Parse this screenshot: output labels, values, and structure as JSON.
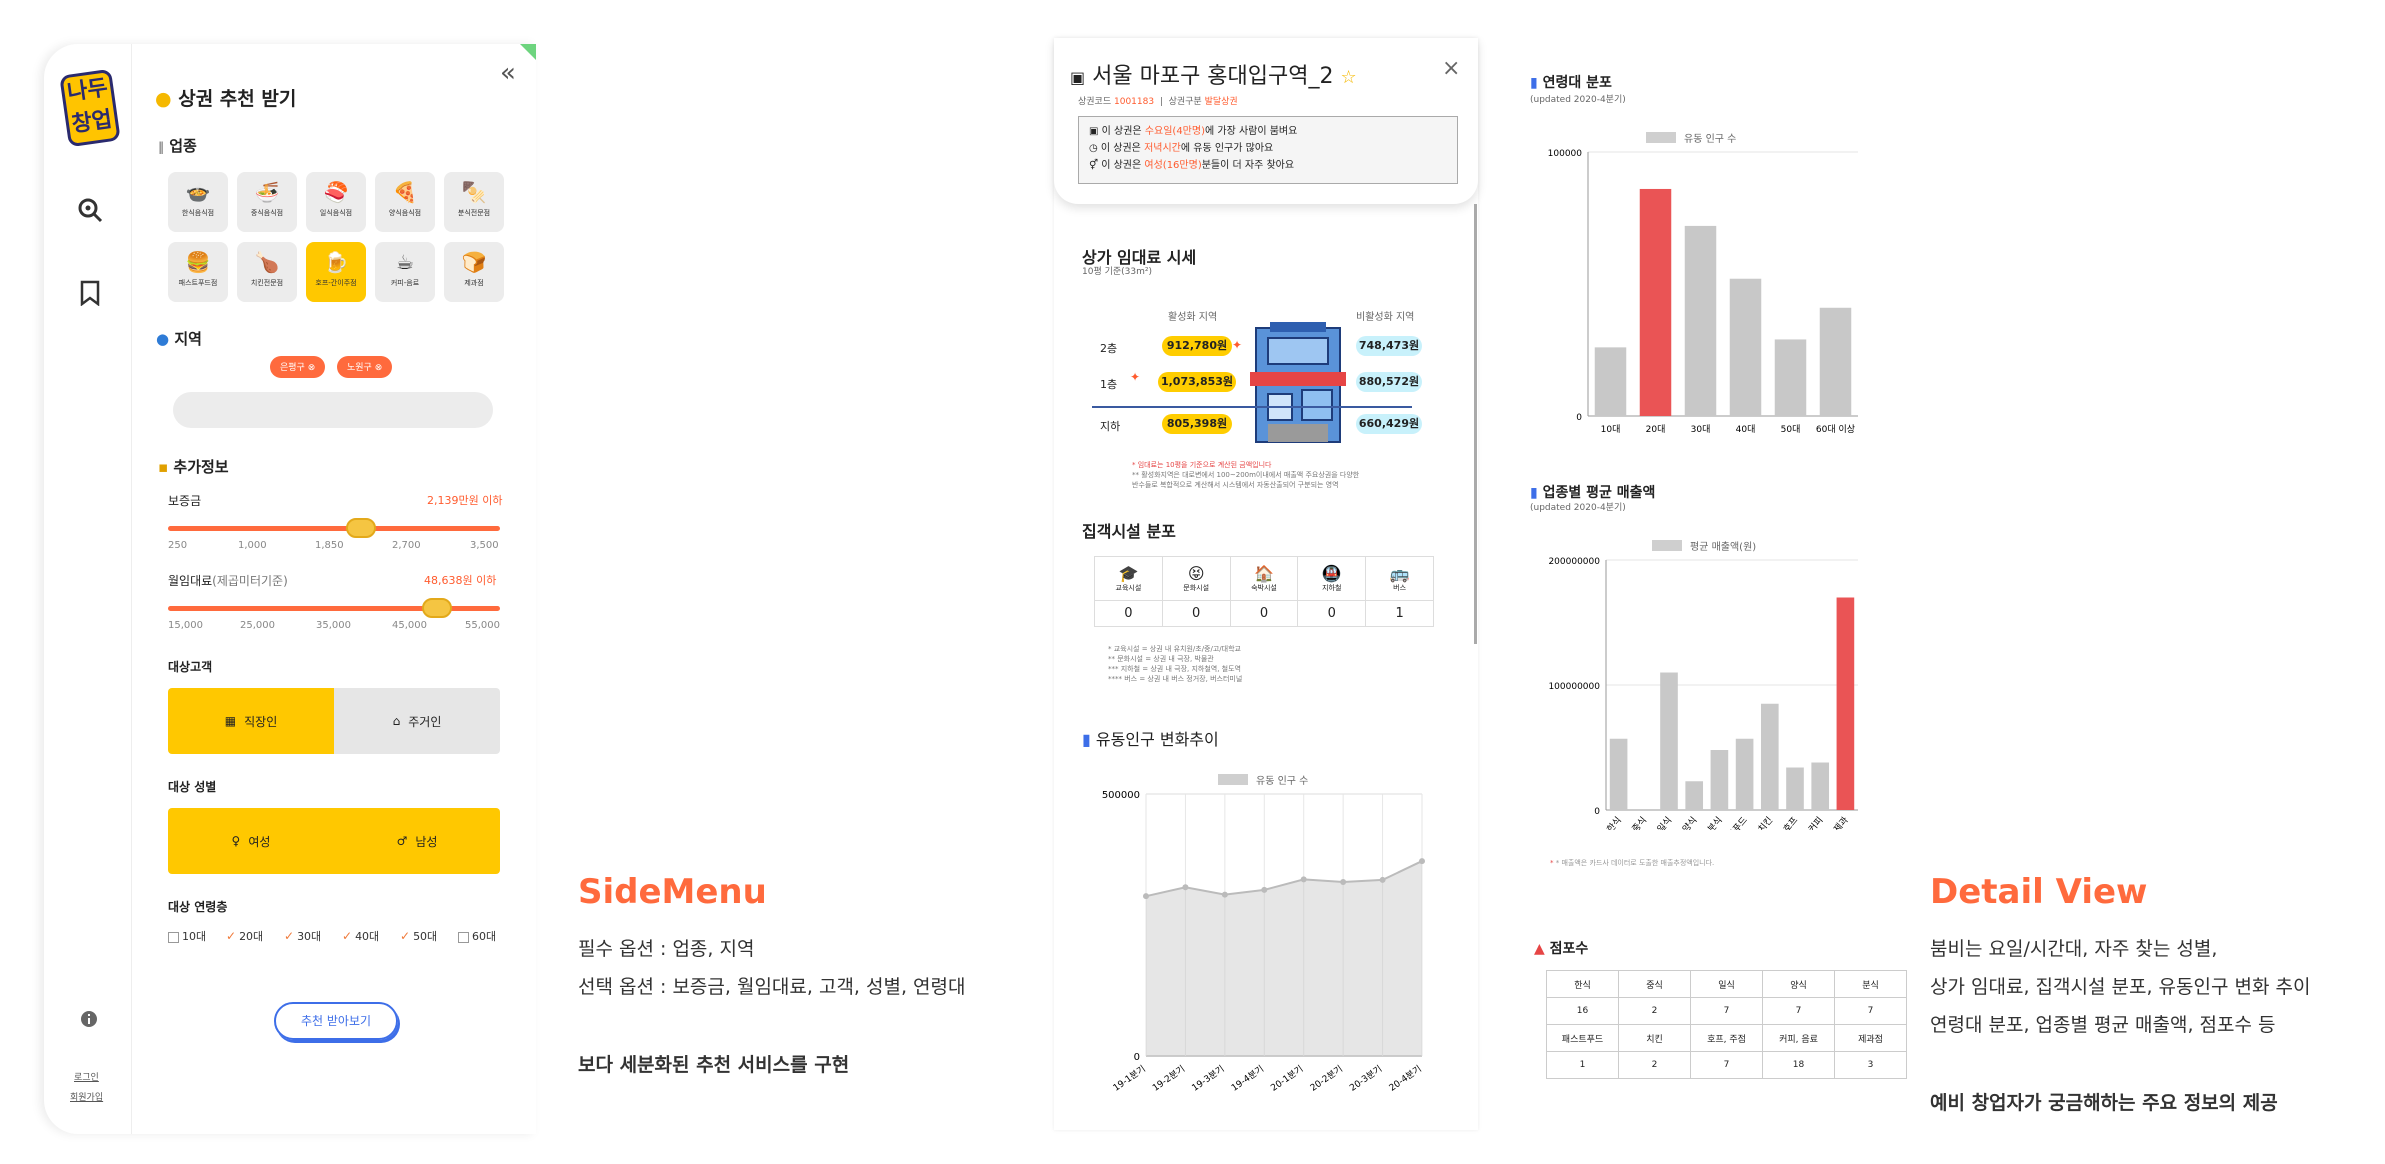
{
  "side": {
    "title": "상권 추천 받기",
    "industry_title": "업종",
    "categories": [
      {
        "label": "한식음식점",
        "icon": "🍲",
        "selected": false
      },
      {
        "label": "중식음식점",
        "icon": "🍜",
        "selected": false
      },
      {
        "label": "일식음식점",
        "icon": "🍣",
        "selected": false
      },
      {
        "label": "양식음식점",
        "icon": "🍕",
        "selected": false
      },
      {
        "label": "분식전문점",
        "icon": "🍢",
        "selected": false
      },
      {
        "label": "패스트푸드점",
        "icon": "🍔",
        "selected": false
      },
      {
        "label": "치킨전문점",
        "icon": "🍗",
        "selected": false
      },
      {
        "label": "호프-간이주점",
        "icon": "🍺",
        "selected": true
      },
      {
        "label": "커피-음료",
        "icon": "☕",
        "selected": false
      },
      {
        "label": "제과점",
        "icon": "🍞",
        "selected": false
      }
    ],
    "region_title": "지역",
    "regions": [
      "은평구",
      "노원구"
    ],
    "extra_title": "추가정보",
    "deposit": {
      "label": "보증금",
      "value": "2,139만원 이하",
      "ticks": [
        "250",
        "1,000",
        "1,850",
        "2,700",
        "3,500"
      ],
      "position": 0.58
    },
    "rent": {
      "label": "월임대료",
      "unit": "(제곱미터기준)",
      "value": "48,638원 이하",
      "ticks": [
        "15,000",
        "25,000",
        "35,000",
        "45,000",
        "55,000"
      ],
      "position": 0.81
    },
    "target_customer": {
      "label": "대상고객",
      "options": [
        "직장인",
        "주거인"
      ],
      "selected": "직장인"
    },
    "target_gender": {
      "label": "대상 성별",
      "options": [
        "여성",
        "남성"
      ]
    },
    "age": {
      "label": "대상 연령층",
      "options": [
        {
          "t": "10대",
          "c": false
        },
        {
          "t": "20대",
          "c": true
        },
        {
          "t": "30대",
          "c": true
        },
        {
          "t": "40대",
          "c": true
        },
        {
          "t": "50대",
          "c": true
        },
        {
          "t": "60대",
          "c": false
        }
      ]
    },
    "submit": "추천 받아보기",
    "login": "로그인",
    "signup": "회원가입",
    "collapse": "«",
    "logo": "나두 창업"
  },
  "left_desc": {
    "heading": "SideMenu",
    "line1": "필수 옵션 : 업종, 지역",
    "line2": "선택 옵션 : 보증금, 월임대료, 고객, 성별, 연령대",
    "line3": "보다 세분화된 추천 서비스를 구현"
  },
  "detail": {
    "title": "서울 마포구 홍대입구역_2",
    "code_label": "상권코드",
    "code": "1001183",
    "type_label": "상권구분",
    "type": "발달상권",
    "info1": [
      "이 상권은 ",
      "수요일(4만명)",
      "에 가장 사람이 붐벼요"
    ],
    "info2": [
      "이 상권은 ",
      "저녁시간",
      "에 유동 인구가 많아요"
    ],
    "info3": [
      "이 상권은 ",
      "여성(16만명)",
      "분들이 더 자주 찾아요"
    ],
    "rent_title": "상가 임대료 시세",
    "rent_sub": "10평 기준(33m²)",
    "active": "활성화 지역",
    "inactive": "비활성화 지역",
    "floors": [
      {
        "floor": "2층",
        "active": "912,780원",
        "inactive": "748,473원"
      },
      {
        "floor": "1층",
        "active": "1,073,853원",
        "inactive": "880,572원"
      },
      {
        "floor": "지하",
        "active": "805,398원",
        "inactive": "660,429원"
      }
    ],
    "rent_notes": [
      "* 임대료는 10평을 기준으로 계산된 금액입니다",
      "** 활성화지역은 대로변에서 100~200m이내에서 매출액 주요상권을 다양한",
      "반수들로 복합적으로 계산해서 시스템에서 자동산출되어 구분되는 영역"
    ],
    "facility_title": "집객시설 분포",
    "facilities": [
      {
        "label": "교육시설",
        "icon": "🎓",
        "count": "0"
      },
      {
        "label": "문화시설",
        "icon": "😝",
        "count": "0"
      },
      {
        "label": "숙박시설",
        "icon": "🏠",
        "count": "0"
      },
      {
        "label": "지하철",
        "icon": "🚇",
        "count": "0"
      },
      {
        "label": "버스",
        "icon": "🚌",
        "count": "1"
      }
    ],
    "facility_notes": [
      "* 교육시설 = 상권 내 유치원/초/중/고/대학교",
      "** 문화시설 = 상권 내 극장, 박물관",
      "*** 지하철 = 상권 내 극장, 지하철역, 철도역",
      "**** 버스 = 상권 내 버스 정거장, 버스터미널"
    ],
    "close": "×",
    "star": "☆"
  },
  "right_desc": {
    "heading": "Detail View",
    "line1": "붐비는 요일/시간대, 자주 찾는 성별,",
    "line2": "상가 임대료, 집객시설 분포, 유동인구 변화 추이",
    "line3": "연령대 분포, 업종별 평균 매출액, 점포수 등",
    "line4": "예비 창업자가 궁금해하는 주요 정보의 제공"
  },
  "chart_titles": {
    "flow": "유동인구 변화추이",
    "age": "연령대 분포",
    "age_sub": "(updated 2020-4분기)",
    "sales": "업종별 평균 매출액",
    "sales_sub": "(updated 2020-4분기)",
    "sales_note": "* 매출액은 카드사 데이터로 도출한 매출추정액입니다.",
    "stores": "점포수"
  },
  "store_table": [
    [
      "한식",
      "중식",
      "일식",
      "양식",
      "분식"
    ],
    [
      "16",
      "2",
      "7",
      "7",
      "7"
    ],
    [
      "패스트푸드",
      "치킨",
      "호프, 주점",
      "커피, 음료",
      "제과점"
    ],
    [
      "1",
      "2",
      "7",
      "18",
      "3"
    ]
  ],
  "chart_data": [
    {
      "type": "area",
      "legend": [
        "유동 인구 수"
      ],
      "categories": [
        "19-1분기",
        "19-2분기",
        "19-3분기",
        "19-4분기",
        "20-1분기",
        "20-2분기",
        "20-3분기",
        "20-4분기"
      ],
      "series": [
        {
          "name": "유동 인구 수",
          "values": [
            305000,
            322000,
            308000,
            317000,
            337000,
            332000,
            336000,
            372000
          ]
        }
      ],
      "ylim": [
        0,
        500000
      ],
      "yticks": [
        "500000",
        "0"
      ]
    },
    {
      "type": "bar",
      "legend": [
        "유동 인구 수"
      ],
      "categories": [
        "10대",
        "20대",
        "30대",
        "40대",
        "50대",
        "60대 이상"
      ],
      "series": [
        {
          "name": "유동 인구 수",
          "values": [
            26000,
            86000,
            72000,
            52000,
            29000,
            41000
          ]
        }
      ],
      "highlight_index": 1,
      "ylim": [
        0,
        100000
      ],
      "yticks": [
        "100000",
        "0"
      ]
    },
    {
      "type": "bar",
      "legend": [
        "평균 매출액(원)"
      ],
      "categories": [
        "한식",
        "중식",
        "일식",
        "양식",
        "분식",
        "패스트푸드",
        "치킨",
        "호프",
        "커피",
        "제과"
      ],
      "series": [
        {
          "name": "평균 매출액(원)",
          "values": [
            57000000,
            0,
            110000000,
            23000000,
            48000000,
            57000000,
            85000000,
            34000000,
            38000000,
            170000000
          ]
        }
      ],
      "highlight_index": 9,
      "ylim": [
        0,
        200000000
      ],
      "yticks": [
        "200000000",
        "100000000",
        "0"
      ]
    }
  ],
  "colors": {
    "accent": "#ff6a3d",
    "yellow": "#ffc800",
    "highlight_bar": "#ea5455",
    "bar": "#c8c8c8"
  }
}
